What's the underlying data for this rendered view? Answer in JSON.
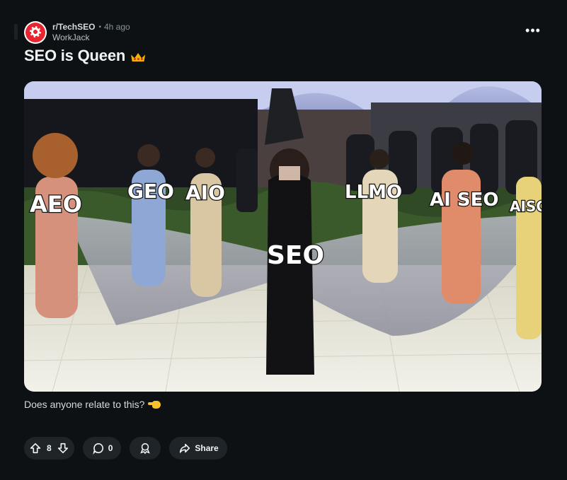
{
  "post": {
    "subreddit": "r/TechSEO",
    "separator": "•",
    "time": "4h ago",
    "author": "WorkJack",
    "title": "SEO is Queen",
    "title_emoji_icon": "crown-icon",
    "body": "Does anyone relate to this?",
    "body_emoji_icon": "pointing-hand-icon",
    "image_labels": [
      "AEO",
      "GEO",
      "AIO",
      "LLMO",
      "AI SEO",
      "AISO",
      "SEO"
    ]
  },
  "actions": {
    "upvote_icon": "arrow-up-icon",
    "vote_count": "8",
    "downvote_icon": "arrow-down-icon",
    "comment_icon": "comment-bubble-icon",
    "comment_count": "0",
    "award_icon": "award-icon",
    "share_icon": "share-arrow-icon",
    "share_label": "Share"
  },
  "colors": {
    "background": "#0e1113",
    "pill": "#1e2427",
    "avatar_red": "#e8242f",
    "meta_gray": "#82959b"
  }
}
